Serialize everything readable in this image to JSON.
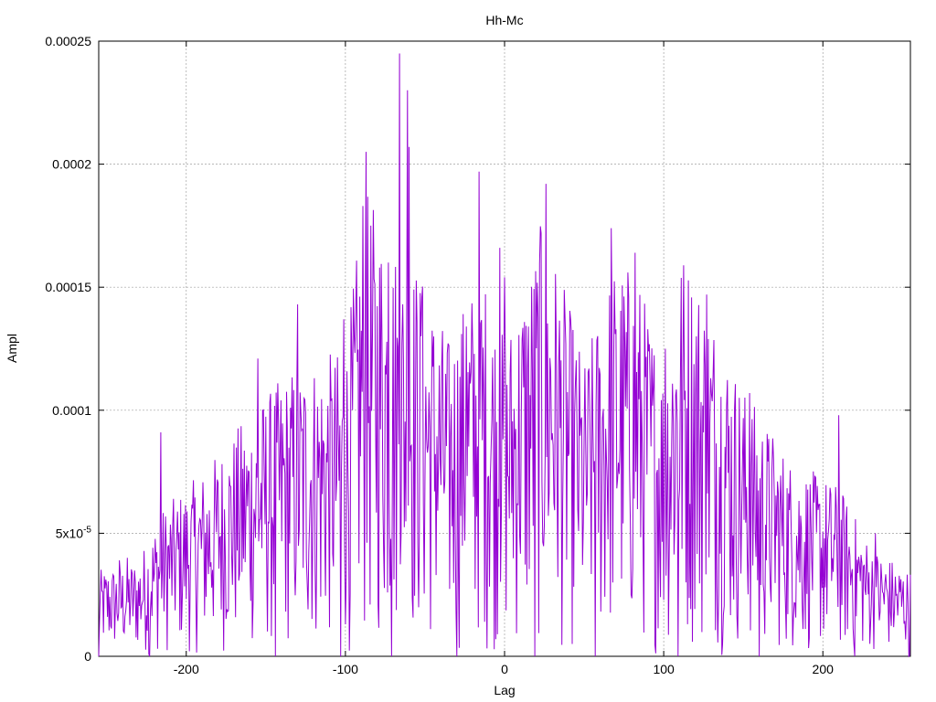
{
  "chart_data": {
    "type": "line",
    "title": "Hh-Mc",
    "xlabel": "Lag",
    "ylabel": "Ampl",
    "xlim": [
      -255,
      255
    ],
    "ylim": [
      0,
      0.00025
    ],
    "x_ticks": [
      -200,
      -100,
      0,
      100,
      200
    ],
    "x_tick_labels": [
      "-200",
      "-100",
      "0",
      "100",
      "200"
    ],
    "y_ticks": [
      0,
      5e-05,
      0.0001,
      0.00015,
      0.0002,
      0.00025
    ],
    "y_tick_labels": [
      "0",
      "5x10-5",
      "0.0001",
      "0.00015",
      "0.0002",
      "0.00025"
    ],
    "grid": true,
    "series_color": "#9400D3",
    "envelope": [
      [
        -255,
        3.5e-05
      ],
      [
        -230,
        4e-05
      ],
      [
        -215,
        6e-05
      ],
      [
        -190,
        7.5e-05
      ],
      [
        -160,
        0.0001
      ],
      [
        -130,
        0.00012
      ],
      [
        -100,
        0.000125
      ],
      [
        -88,
        0.00019
      ],
      [
        -70,
        0.00017
      ],
      [
        -55,
        0.00016
      ],
      [
        -35,
        0.00013
      ],
      [
        -15,
        0.00016
      ],
      [
        0,
        0.00013
      ],
      [
        25,
        0.00018
      ],
      [
        50,
        0.00012
      ],
      [
        68,
        0.00016
      ],
      [
        82,
        0.00016
      ],
      [
        100,
        0.00012
      ],
      [
        110,
        0.00017
      ],
      [
        126,
        0.00015
      ],
      [
        150,
        0.00011
      ],
      [
        180,
        8e-05
      ],
      [
        210,
        7e-05
      ],
      [
        230,
        4.5e-05
      ],
      [
        255,
        3.5e-05
      ]
    ],
    "peaks": [
      {
        "x": -66,
        "y": 0.000245
      },
      {
        "x": -61,
        "y": 0.00023
      },
      {
        "x": -87,
        "y": 0.000205
      },
      {
        "x": -60,
        "y": 0.000207
      },
      {
        "x": -89,
        "y": 0.000183
      },
      {
        "x": -16,
        "y": 0.000197
      },
      {
        "x": 26,
        "y": 0.000192
      },
      {
        "x": 109,
        "y": 0.000187
      },
      {
        "x": -73,
        "y": 0.00016
      },
      {
        "x": 67,
        "y": 0.000174
      },
      {
        "x": 23,
        "y": 0.000172
      },
      {
        "x": -3,
        "y": 0.000166
      },
      {
        "x": 82,
        "y": 0.000164
      },
      {
        "x": 127,
        "y": 0.000147
      },
      {
        "x": -130,
        "y": 0.000143
      },
      {
        "x": -101,
        "y": 0.000137
      },
      {
        "x": -155,
        "y": 0.000121
      },
      {
        "x": -216,
        "y": 9.1e-05
      },
      {
        "x": 210,
        "y": 9.8e-05
      },
      {
        "x": 154,
        "y": 0.000107
      },
      {
        "x": -52,
        "y": 0.000146
      },
      {
        "x": 0,
        "y": 0.000154
      },
      {
        "x": 101,
        "y": 0.000125
      },
      {
        "x": 57,
        "y": 0.000128
      },
      {
        "x": -24,
        "y": 0.000134
      },
      {
        "x": 233,
        "y": 5e-05
      },
      {
        "x": -237,
        "y": 4e-05
      },
      {
        "x": -242,
        "y": 3.9e-05
      }
    ],
    "zeros": [
      -255,
      -223,
      -144,
      -103,
      -71,
      -30,
      19,
      57,
      109,
      160,
      220,
      254
    ]
  }
}
